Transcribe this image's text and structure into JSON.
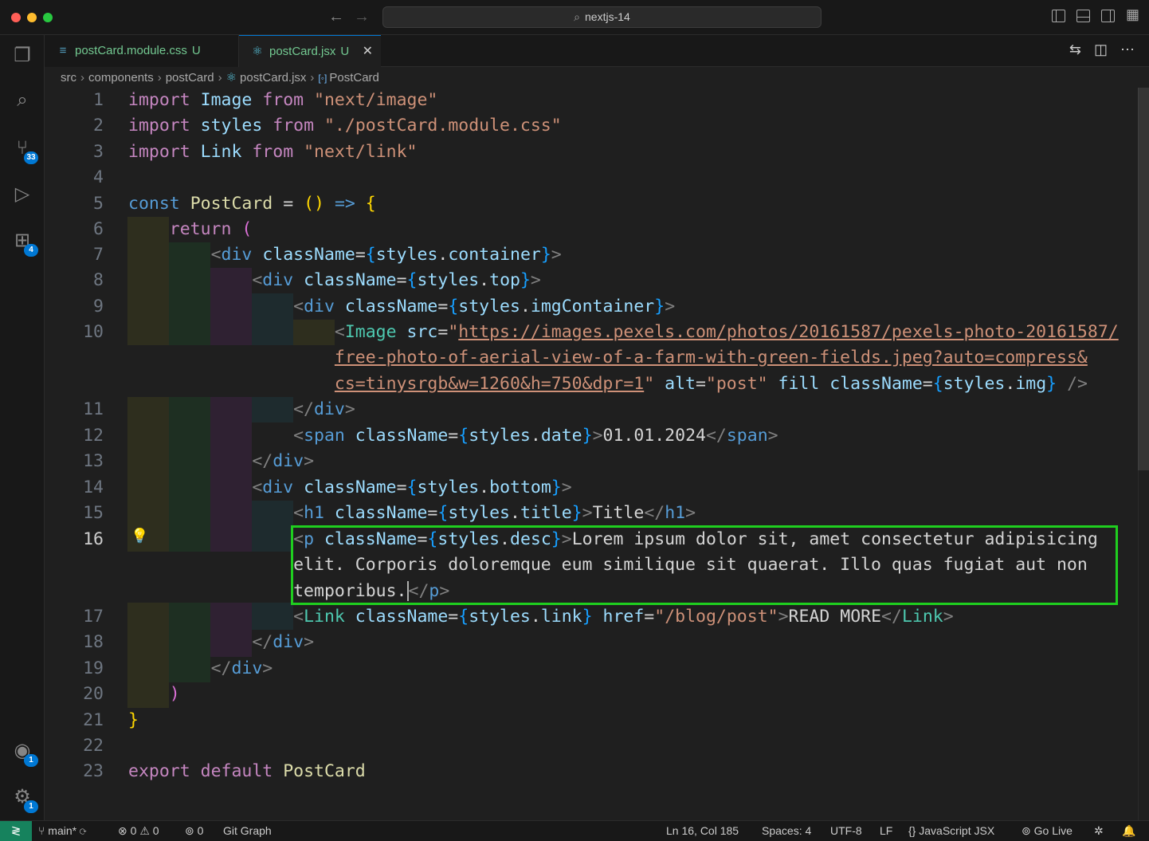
{
  "window": {
    "search_text": "nextjs-14"
  },
  "activity": {
    "source_control_badge": "33",
    "extensions_badge": "4",
    "accounts_badge": "1",
    "manage_badge": "1"
  },
  "tabs": [
    {
      "label": "postCard.module.css",
      "status": "U"
    },
    {
      "label": "postCard.jsx",
      "status": "U"
    }
  ],
  "breadcrumb": [
    "src",
    "components",
    "postCard",
    "postCard.jsx",
    "PostCard"
  ],
  "editor": {
    "line_numbers": [
      "1",
      "2",
      "3",
      "4",
      "5",
      "6",
      "7",
      "8",
      "9",
      "10",
      "11",
      "12",
      "13",
      "14",
      "15",
      "16",
      "17",
      "18",
      "19",
      "20",
      "21",
      "22",
      "23"
    ],
    "l1": {
      "import": "import",
      "name": "Image",
      "from": "from",
      "module": "\"next/image\""
    },
    "l2": {
      "import": "import",
      "name": "styles",
      "from": "from",
      "module": "\"./postCard.module.css\""
    },
    "l3": {
      "import": "import",
      "name": "Link",
      "from": "from",
      "module": "\"next/link\""
    },
    "l5": {
      "const": "const",
      "name": "PostCard",
      "eq": "=",
      "parens": "()",
      "arrow": "=>",
      "brace": "{"
    },
    "l6": {
      "return": "return",
      "paren": "("
    },
    "l7": {
      "tag": "div",
      "attr": "className",
      "obj": "styles",
      "prop": "container"
    },
    "l8": {
      "tag": "div",
      "attr": "className",
      "obj": "styles",
      "prop": "top"
    },
    "l9": {
      "tag": "div",
      "attr": "className",
      "obj": "styles",
      "prop": "imgContainer"
    },
    "l10": {
      "tag": "Image",
      "src_attr": "src",
      "url_part1": "https://images.pexels.com/photos/20161587/pexels-photo-20161587/",
      "url_part2": "free-photo-of-aerial-view-of-a-farm-with-green-fields.jpeg?auto=compress&",
      "url_part3": "cs=tinysrgb&w=1260&h=750&dpr=1",
      "alt_attr": "alt",
      "alt_val": "\"post\"",
      "fill": "fill",
      "class_attr": "className",
      "obj": "styles",
      "prop": "img"
    },
    "l11": {
      "tag": "div"
    },
    "l12": {
      "tag": "span",
      "attr": "className",
      "obj": "styles",
      "prop": "date",
      "text": "01.01.2024"
    },
    "l13": {
      "tag": "div"
    },
    "l14": {
      "tag": "div",
      "attr": "className",
      "obj": "styles",
      "prop": "bottom"
    },
    "l15": {
      "tag": "h1",
      "attr": "className",
      "obj": "styles",
      "prop": "title",
      "text": "Title"
    },
    "l16": {
      "tag": "p",
      "attr": "className",
      "obj": "styles",
      "prop": "desc",
      "text1": "Lorem ipsum dolor sit, amet consectetur adipisicing",
      "text2": "elit. Corporis doloremque eum similique sit quaerat. Illo quas fugiat aut non",
      "text3": "temporibus."
    },
    "l17": {
      "tag": "Link",
      "attr": "className",
      "obj": "styles",
      "prop": "link",
      "href_attr": "href",
      "href": "\"/blog/post\"",
      "text": "READ MORE"
    },
    "l18": {
      "tag": "div"
    },
    "l19": {
      "tag": "div"
    },
    "l20": {
      "paren": ")"
    },
    "l21": {
      "brace": "}"
    },
    "l23": {
      "export": "export",
      "default": "default",
      "name": "PostCard"
    }
  },
  "status": {
    "branch": "main*",
    "errors": "0",
    "warnings": "0",
    "ports": "0",
    "git_graph": "Git Graph",
    "position": "Ln 16, Col 185",
    "spaces": "Spaces: 4",
    "encoding": "UTF-8",
    "eol": "LF",
    "language": "JavaScript JSX",
    "go_live": "Go Live"
  }
}
